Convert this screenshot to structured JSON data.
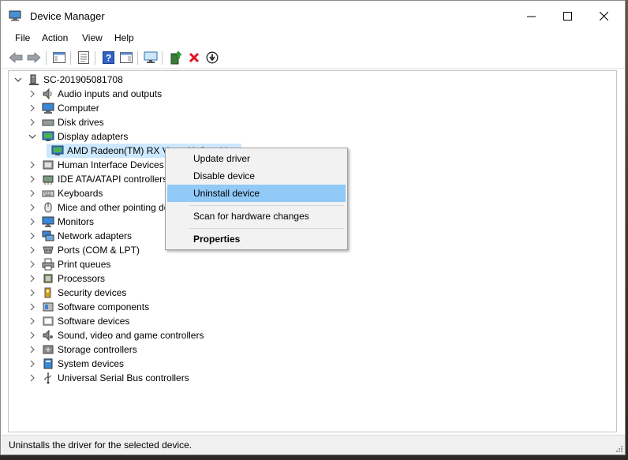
{
  "window": {
    "title": "Device Manager"
  },
  "menu": [
    "File",
    "Action",
    "View",
    "Help"
  ],
  "toolbar": {
    "icons": [
      "back-arrow-icon",
      "forward-arrow-icon",
      "show-hide-console-tree-icon",
      "properties-icon",
      "help-icon",
      "show-hide-action-pane-icon",
      "monitor-scan-icon",
      "update-driver-icon",
      "uninstall-x-icon",
      "disable-device-icon"
    ]
  },
  "tree": {
    "root": "SC-201905081708",
    "categories": [
      {
        "label": "Audio inputs and outputs",
        "icon": "speaker-icon"
      },
      {
        "label": "Computer",
        "icon": "computer-icon"
      },
      {
        "label": "Disk drives",
        "icon": "disk-drive-icon"
      },
      {
        "label": "Display adapters",
        "icon": "display-adapter-icon",
        "expanded": true
      },
      {
        "label": "AMD Radeon(TM) RX Vega 11 Graphics",
        "icon": "display-adapter-icon",
        "child": true,
        "selected": true
      },
      {
        "label": "Human Interface Devices",
        "icon": "hid-icon"
      },
      {
        "label": "IDE ATA/ATAPI controllers",
        "icon": "ide-controller-icon"
      },
      {
        "label": "Keyboards",
        "icon": "keyboard-icon"
      },
      {
        "label": "Mice and other pointing devices",
        "icon": "mouse-icon"
      },
      {
        "label": "Monitors",
        "icon": "monitor-icon"
      },
      {
        "label": "Network adapters",
        "icon": "network-adapter-icon"
      },
      {
        "label": "Ports (COM & LPT)",
        "icon": "port-icon"
      },
      {
        "label": "Print queues",
        "icon": "printer-icon"
      },
      {
        "label": "Processors",
        "icon": "processor-icon"
      },
      {
        "label": "Security devices",
        "icon": "security-icon"
      },
      {
        "label": "Software components",
        "icon": "software-component-icon"
      },
      {
        "label": "Software devices",
        "icon": "software-device-icon"
      },
      {
        "label": "Sound, video and game controllers",
        "icon": "sound-icon"
      },
      {
        "label": "Storage controllers",
        "icon": "storage-controller-icon"
      },
      {
        "label": "System devices",
        "icon": "system-device-icon"
      },
      {
        "label": "Universal Serial Bus controllers",
        "icon": "usb-icon"
      }
    ]
  },
  "context_menu": {
    "items": [
      "Update driver",
      "Disable device",
      "Uninstall device",
      "Scan for hardware changes",
      "Properties"
    ],
    "highlighted": "Uninstall device"
  },
  "status": "Uninstalls the driver for the selected device.",
  "colors": {
    "selection": "#cce8ff",
    "menu_hover": "#91c9f7",
    "uninstall_red": "#e81123"
  }
}
